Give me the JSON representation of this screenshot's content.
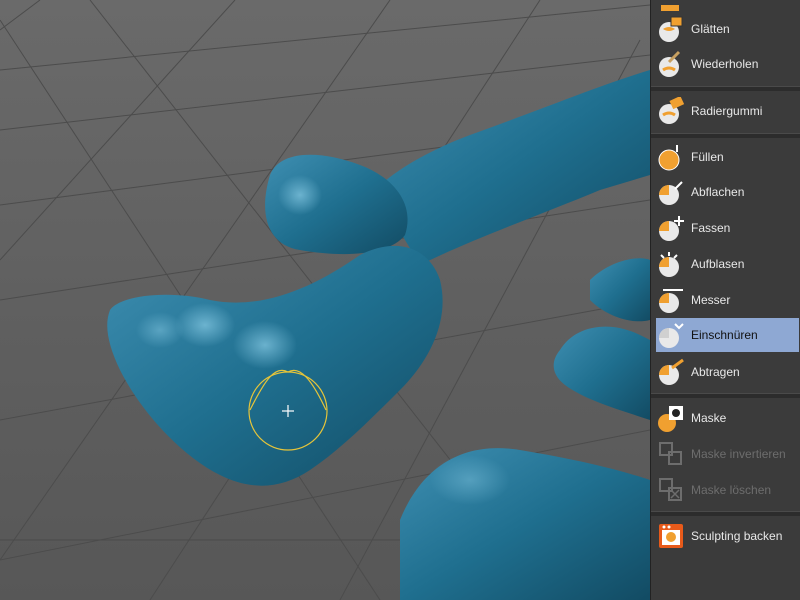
{
  "viewport": {
    "name": "3D Viewport",
    "model_color": "#1f6f8f",
    "brush_color": "#e5c43a"
  },
  "tools": [
    {
      "label": "Glätten",
      "icon": "smooth-brush-icon",
      "state": "normal"
    },
    {
      "label": "Wiederholen",
      "icon": "repeat-brush-icon",
      "state": "normal"
    },
    {
      "label": "Radiergummi",
      "icon": "eraser-brush-icon",
      "state": "normal"
    },
    {
      "label": "Füllen",
      "icon": "fill-brush-icon",
      "state": "normal"
    },
    {
      "label": "Abflachen",
      "icon": "flatten-brush-icon",
      "state": "normal"
    },
    {
      "label": "Fassen",
      "icon": "grab-brush-icon",
      "state": "normal"
    },
    {
      "label": "Aufblasen",
      "icon": "inflate-brush-icon",
      "state": "normal"
    },
    {
      "label": "Messer",
      "icon": "knife-brush-icon",
      "state": "normal"
    },
    {
      "label": "Einschnüren",
      "icon": "pinch-brush-icon",
      "state": "selected"
    },
    {
      "label": "Abtragen",
      "icon": "scrape-brush-icon",
      "state": "normal"
    },
    {
      "label": "Maske",
      "icon": "mask-brush-icon",
      "state": "normal"
    },
    {
      "label": "Maske invertieren",
      "icon": "mask-invert-icon",
      "state": "disabled"
    },
    {
      "label": "Maske löschen",
      "icon": "mask-clear-icon",
      "state": "disabled"
    },
    {
      "label": "Sculpting backen",
      "icon": "bake-sculpt-icon",
      "state": "normal"
    }
  ],
  "colors": {
    "panel_bg": "#3b3b3b",
    "selected_bg": "#8ea8d3",
    "icon_orange": "#f0a030"
  }
}
